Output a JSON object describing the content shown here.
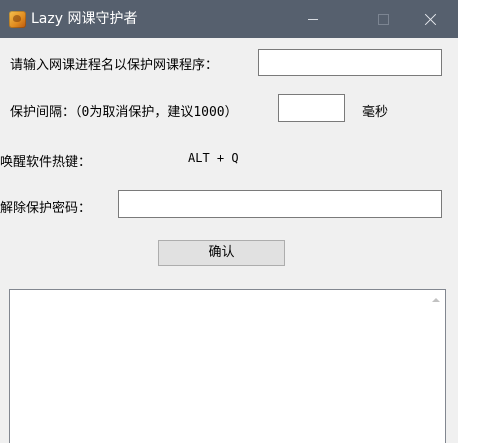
{
  "window": {
    "title": "Lazy 网课守护者",
    "minimize_glyph": "",
    "maximize_glyph": "",
    "close_glyph": ""
  },
  "form": {
    "process_label": "请输入网课进程名以保护网课程序：",
    "process_value": "",
    "interval_label": "保护间隔：（0为取消保护，建议1000）",
    "interval_value": "",
    "interval_unit": "毫秒",
    "hotkey_label": "唤醒软件热键：",
    "hotkey_value": "ALT + Q",
    "password_label": "解除保护密码：",
    "password_value": "",
    "confirm_label": "确认"
  },
  "log": {
    "content": ""
  },
  "colors": {
    "titlebar": "#56606e",
    "window_bg": "#f0f0f0"
  }
}
